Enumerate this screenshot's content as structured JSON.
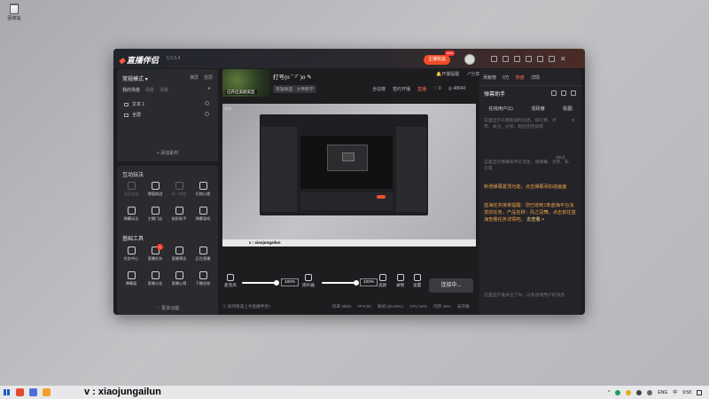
{
  "desktop": {
    "recycle_bin_label": "回收站"
  },
  "app": {
    "logo": "直播伴侣",
    "version": "6.5.5.4",
    "top_broadcast": "主播权益",
    "top_broadcast_badge": "new",
    "left": {
      "mode": "常规模式",
      "mode_arrow": "▾",
      "mode_links": [
        "横屏",
        "竖屏"
      ],
      "scene_tabs": [
        "我的场景",
        "场景",
        "场景"
      ],
      "add_plus": "+",
      "sources": [
        "文本 1",
        "全屏"
      ],
      "add_source": "+ 添加素材",
      "interactive_title": "互动玩法",
      "interactive_tools": [
        {
          "label": "语音连线",
          "dim": true
        },
        {
          "label": "增值挑战",
          "dim": false
        },
        {
          "label": "同一首歌",
          "dim": true
        },
        {
          "label": "礼物心愿",
          "dim": false
        },
        {
          "label": "弹幕玩法",
          "dim": false
        },
        {
          "label": "主播门店",
          "dim": false
        },
        {
          "label": "贴纸助手",
          "dim": false
        },
        {
          "label": "弹幕游戏",
          "dim": false
        }
      ],
      "basic_title": "基础工具",
      "basic_tools": [
        {
          "label": "任务中心",
          "badge": ""
        },
        {
          "label": "直播任务",
          "badge": "1"
        },
        {
          "label": "直播预告",
          "badge": ""
        },
        {
          "label": "正在直播",
          "badge": ""
        },
        {
          "label": "弹幕窗",
          "badge": ""
        },
        {
          "label": "直播公告",
          "badge": ""
        },
        {
          "label": "直播心得",
          "badge": ""
        },
        {
          "label": "下播总结",
          "badge": ""
        }
      ],
      "more": "⋯ 更多功能"
    },
    "room": {
      "thumb_label": "已开启美颜美型",
      "title": "打号(o ˘ ³˘ )o",
      "tag": "英雄联盟 · 大神教学",
      "links": [
        "开播提醒",
        "分享"
      ],
      "actions": [
        "全站榜",
        "签约开播",
        "直播"
      ],
      "likes": "0",
      "viewers": "48640"
    },
    "preview": {
      "tiny_label": "直播",
      "caption": "v : xiaojungailun"
    },
    "controls": {
      "mic_label": "麦克风",
      "mic_pct": "100%",
      "mic_level": 1.0,
      "speaker_label": "扬声器",
      "speaker_pct": "100%",
      "speaker_level": 1.0,
      "beauty_label": "美颜",
      "record_label": "录制",
      "settings_label": "设置",
      "start_button": "连接中..."
    },
    "status": {
      "tip": "ⓘ 如何快速上手直播伴侣?",
      "stats": [
        "码率 0kb/s",
        "FPS:60",
        "丢帧 0(0.00%)",
        "CPU:10%",
        "内存 46%",
        "未开播"
      ]
    },
    "right": {
      "tabs": [
        "贡献榜",
        "0万",
        "热度",
        "详情"
      ],
      "panel_title": "弹幕助手",
      "subtabs": [
        "在线用户(1)",
        "活跃度",
        "贴图"
      ],
      "placeholder_top": "这里显示礼物和福利消息，如礼物、点赞、关注、分享、粉丝团活动等",
      "counter1": "0",
      "placeholder_mid": "这里显示弹幕和评论消息，如弹幕、点赞、私信等",
      "counter2": "0/0人",
      "notice1": "新增弹幕置顶功能，点击弹幕添加进画面",
      "notice2": "蓝海任务接单提醒：您已收到1条蓝海平台派发的任务，产品名称：风之冠舞。点击前往蓝海查看任务详情吧。",
      "notice2_link": "去查看 >",
      "placeholder_bottom": "这里显示谁关注了你，以及进场用户的消息"
    }
  },
  "taskbar": {
    "caption": "v : xiaojungailun",
    "tray": [
      "ENG",
      "中",
      "9:58"
    ]
  }
}
